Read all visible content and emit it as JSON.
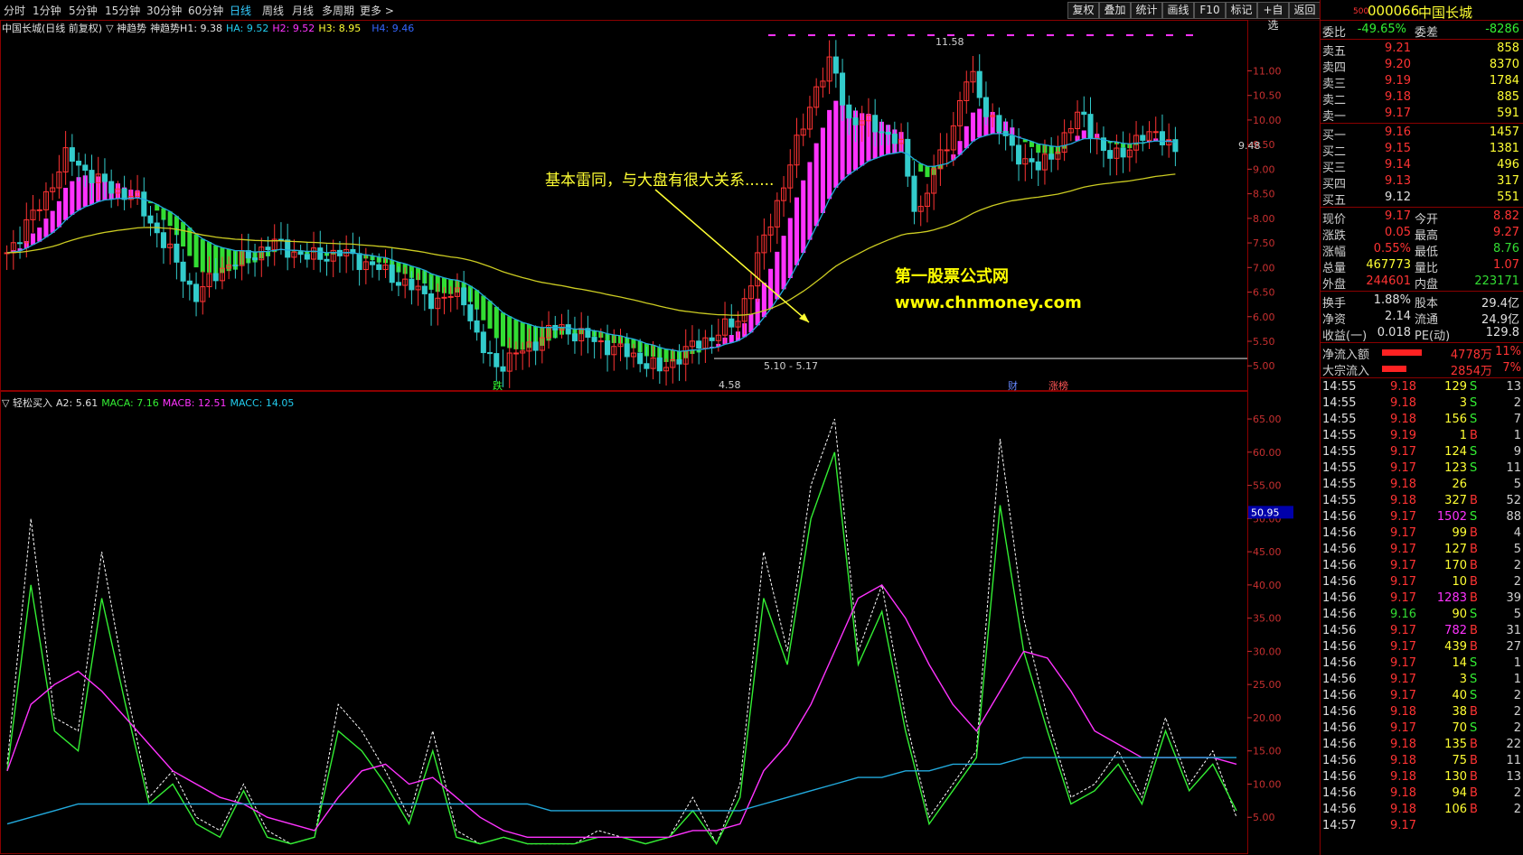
{
  "toolbar": {
    "periods": [
      "分时",
      "1分钟",
      "5分钟",
      "15分钟",
      "30分钟",
      "60分钟",
      "日线",
      "周线",
      "月线",
      "多周期",
      "更多 >"
    ],
    "active_period": "日线",
    "buttons": [
      "复权",
      "叠加",
      "统计",
      "画线",
      "F10",
      "标记",
      "+自选",
      "返回"
    ]
  },
  "main_chart": {
    "legend": {
      "title": "中国长城(日线 前复权)",
      "indicator": "▽ 神趋势",
      "indicator2": "神趋势H1: 9.38",
      "ha": "HA: 9.52",
      "h2": "H2: 9.52",
      "h3": "H3: 8.95",
      "h4": "H4: 9.46"
    },
    "price_axis": [
      "11.00",
      "10.50",
      "10.00",
      "9.50",
      "9.00",
      "8.50",
      "8.00",
      "7.50",
      "7.00",
      "6.50",
      "6.00",
      "5.50",
      "5.00"
    ],
    "price_axis_values": [
      11.0,
      10.5,
      10.0,
      9.5,
      9.0,
      8.5,
      8.0,
      7.5,
      7.0,
      6.5,
      6.0,
      5.5,
      5.0
    ],
    "price_range": [
      4.6,
      12.0
    ],
    "high_label": "11.58",
    "low_label": "4.58",
    "range_label": "5.10 - 5.17",
    "last_label": "9.48",
    "annotation": "基本雷同，与大盘有很大关系......",
    "watermark_name": "第一股票公式网",
    "watermark_url": "www.chnmoney.com",
    "event_tags": [
      "跌",
      "财",
      "涨榜"
    ],
    "colors": {
      "up_bar": "#ff33ff",
      "down_bar": "#33dd33",
      "ma_fast": "#22aadd",
      "ma_slow": "#cccc22",
      "candle_up": "#ff3333",
      "candle_down": "#33cccc"
    }
  },
  "sub_chart": {
    "legend": {
      "title": "▽ 轻松买入",
      "a2": "A2: 5.61",
      "maca": "MACA: 7.16",
      "macb": "MACB: 12.51",
      "macc": "MACC: 14.05"
    },
    "axis": [
      "65.00",
      "60.00",
      "55.00",
      "50.00",
      "45.00",
      "40.00",
      "35.00",
      "30.00",
      "25.00",
      "20.00",
      "15.00",
      "10.00",
      "5.00"
    ],
    "axis_values": [
      65,
      60,
      55,
      50,
      45,
      40,
      35,
      30,
      25,
      20,
      15,
      10,
      5
    ],
    "range": [
      0,
      68
    ],
    "current_marker": "50.95",
    "current_value": 50.95
  },
  "chart_data": {
    "type": "line",
    "x_description": "daily bars",
    "series": [
      {
        "name": "A2",
        "values": [
          13,
          50,
          20,
          18,
          45,
          25,
          8,
          12,
          5,
          3,
          10,
          3,
          1,
          2,
          22,
          18,
          12,
          5,
          18,
          3,
          1,
          2,
          1,
          1,
          1,
          3,
          2,
          1,
          2,
          8,
          1,
          10,
          45,
          30,
          55,
          65,
          30,
          40,
          20,
          5,
          10,
          15,
          62,
          35,
          20,
          8,
          10,
          15,
          8,
          20,
          10,
          15,
          5
        ]
      },
      {
        "name": "MACA",
        "values": [
          12,
          40,
          18,
          15,
          38,
          22,
          7,
          10,
          4,
          2,
          9,
          2,
          1,
          2,
          18,
          15,
          10,
          4,
          15,
          2,
          1,
          2,
          1,
          1,
          1,
          2,
          2,
          1,
          2,
          6,
          1,
          8,
          38,
          28,
          50,
          60,
          28,
          36,
          18,
          4,
          9,
          14,
          52,
          30,
          18,
          7,
          9,
          13,
          7,
          18,
          9,
          13,
          6
        ]
      },
      {
        "name": "MACB",
        "values": [
          12,
          22,
          25,
          27,
          24,
          20,
          16,
          12,
          10,
          8,
          7,
          5,
          4,
          3,
          8,
          12,
          13,
          10,
          11,
          8,
          5,
          3,
          2,
          2,
          2,
          2,
          2,
          2,
          2,
          3,
          3,
          4,
          12,
          16,
          22,
          30,
          38,
          40,
          35,
          28,
          22,
          18,
          24,
          30,
          29,
          24,
          18,
          16,
          14,
          14,
          14,
          14,
          13
        ]
      },
      {
        "name": "MACC",
        "values": [
          4,
          5,
          6,
          7,
          7,
          7,
          7,
          7,
          7,
          7,
          7,
          7,
          7,
          7,
          7,
          7,
          7,
          7,
          7,
          7,
          7,
          7,
          7,
          6,
          6,
          6,
          6,
          6,
          6,
          6,
          6,
          6,
          7,
          8,
          9,
          10,
          11,
          11,
          12,
          12,
          13,
          13,
          13,
          14,
          14,
          14,
          14,
          14,
          14,
          14,
          14,
          14,
          14
        ]
      }
    ],
    "ylim": [
      0,
      68
    ]
  },
  "quote_panel": {
    "header": {
      "code_prefix": "500",
      "code": "000066",
      "name": "中国长城"
    },
    "weibi": {
      "label": "委比",
      "value": "-49.65%",
      "label2": "委差",
      "value2": "-8286"
    },
    "asks": [
      {
        "label": "卖五",
        "price": "9.21",
        "vol": "858"
      },
      {
        "label": "卖四",
        "price": "9.20",
        "vol": "8370"
      },
      {
        "label": "卖三",
        "price": "9.19",
        "vol": "1784"
      },
      {
        "label": "卖二",
        "price": "9.18",
        "vol": "885"
      },
      {
        "label": "卖一",
        "price": "9.17",
        "vol": "591"
      }
    ],
    "bids": [
      {
        "label": "买一",
        "price": "9.16",
        "vol": "1457"
      },
      {
        "label": "买二",
        "price": "9.15",
        "vol": "1381"
      },
      {
        "label": "买三",
        "price": "9.14",
        "vol": "496"
      },
      {
        "label": "买四",
        "price": "9.13",
        "vol": "317"
      },
      {
        "label": "买五",
        "price": "9.12",
        "vol": "551"
      }
    ],
    "stats": [
      {
        "l1": "现价",
        "v1": "9.17",
        "l2": "今开",
        "v2": "8.82",
        "c1": "#ff3333",
        "c2": "#ff3333"
      },
      {
        "l1": "涨跌",
        "v1": "0.05",
        "l2": "最高",
        "v2": "9.27",
        "c1": "#ff3333",
        "c2": "#ff3333"
      },
      {
        "l1": "涨幅",
        "v1": "0.55%",
        "l2": "最低",
        "v2": "8.76",
        "c1": "#ff3333",
        "c2": "#33dd33"
      },
      {
        "l1": "总量",
        "v1": "467773",
        "l2": "量比",
        "v2": "1.07",
        "c1": "#ffff33",
        "c2": "#ff3333"
      },
      {
        "l1": "外盘",
        "v1": "244601",
        "l2": "内盘",
        "v2": "223171",
        "c1": "#ff3333",
        "c2": "#33dd33"
      }
    ],
    "stats2": [
      {
        "l1": "换手",
        "v1": "1.88%",
        "l2": "股本",
        "v2": "29.4亿"
      },
      {
        "l1": "净资",
        "v1": "2.14",
        "l2": "流通",
        "v2": "24.9亿"
      },
      {
        "l1": "收益(一)",
        "v1": "0.018",
        "l2": "PE(动)",
        "v2": "129.8"
      }
    ],
    "flows": [
      {
        "label": "净流入额",
        "value": "4778万",
        "pct": "11%",
        "bar": 1.0
      },
      {
        "label": "大宗流入",
        "value": "2854万",
        "pct": "7%",
        "bar": 0.62
      }
    ],
    "ticks": [
      {
        "t": "14:55",
        "p": "9.18",
        "v": "129",
        "bs": "S",
        "n": "13",
        "pc": "#ff3333"
      },
      {
        "t": "14:55",
        "p": "9.18",
        "v": "3",
        "bs": "S",
        "n": "2",
        "pc": "#ff3333"
      },
      {
        "t": "14:55",
        "p": "9.18",
        "v": "156",
        "bs": "S",
        "n": "7",
        "pc": "#ff3333"
      },
      {
        "t": "14:55",
        "p": "9.19",
        "v": "1",
        "bs": "B",
        "n": "1",
        "pc": "#ff3333"
      },
      {
        "t": "14:55",
        "p": "9.17",
        "v": "124",
        "bs": "S",
        "n": "9",
        "pc": "#ff3333"
      },
      {
        "t": "14:55",
        "p": "9.17",
        "v": "123",
        "bs": "S",
        "n": "11",
        "pc": "#ff3333"
      },
      {
        "t": "14:55",
        "p": "9.18",
        "v": "26",
        "bs": "",
        "n": "5",
        "pc": "#ff3333"
      },
      {
        "t": "14:55",
        "p": "9.18",
        "v": "327",
        "bs": "B",
        "n": "52",
        "pc": "#ff3333"
      },
      {
        "t": "14:56",
        "p": "9.17",
        "v": "1502",
        "bs": "S",
        "n": "88",
        "pc": "#ff3333"
      },
      {
        "t": "14:56",
        "p": "9.17",
        "v": "99",
        "bs": "B",
        "n": "4",
        "pc": "#ff3333"
      },
      {
        "t": "14:56",
        "p": "9.17",
        "v": "127",
        "bs": "B",
        "n": "5",
        "pc": "#ff3333"
      },
      {
        "t": "14:56",
        "p": "9.17",
        "v": "170",
        "bs": "B",
        "n": "2",
        "pc": "#ff3333"
      },
      {
        "t": "14:56",
        "p": "9.17",
        "v": "10",
        "bs": "B",
        "n": "2",
        "pc": "#ff3333"
      },
      {
        "t": "14:56",
        "p": "9.17",
        "v": "1283",
        "bs": "B",
        "n": "39",
        "pc": "#ff3333"
      },
      {
        "t": "14:56",
        "p": "9.16",
        "v": "90",
        "bs": "S",
        "n": "5",
        "pc": "#33dd33"
      },
      {
        "t": "14:56",
        "p": "9.17",
        "v": "782",
        "bs": "B",
        "n": "31",
        "pc": "#ff3333"
      },
      {
        "t": "14:56",
        "p": "9.17",
        "v": "439",
        "bs": "B",
        "n": "27",
        "pc": "#ff3333"
      },
      {
        "t": "14:56",
        "p": "9.17",
        "v": "14",
        "bs": "S",
        "n": "1",
        "pc": "#ff3333"
      },
      {
        "t": "14:56",
        "p": "9.17",
        "v": "3",
        "bs": "S",
        "n": "1",
        "pc": "#ff3333"
      },
      {
        "t": "14:56",
        "p": "9.17",
        "v": "40",
        "bs": "S",
        "n": "2",
        "pc": "#ff3333"
      },
      {
        "t": "14:56",
        "p": "9.18",
        "v": "38",
        "bs": "B",
        "n": "2",
        "pc": "#ff3333"
      },
      {
        "t": "14:56",
        "p": "9.17",
        "v": "70",
        "bs": "S",
        "n": "2",
        "pc": "#ff3333"
      },
      {
        "t": "14:56",
        "p": "9.18",
        "v": "135",
        "bs": "B",
        "n": "22",
        "pc": "#ff3333"
      },
      {
        "t": "14:56",
        "p": "9.18",
        "v": "75",
        "bs": "B",
        "n": "11",
        "pc": "#ff3333"
      },
      {
        "t": "14:56",
        "p": "9.18",
        "v": "130",
        "bs": "B",
        "n": "13",
        "pc": "#ff3333"
      },
      {
        "t": "14:56",
        "p": "9.18",
        "v": "94",
        "bs": "B",
        "n": "2",
        "pc": "#ff3333"
      },
      {
        "t": "14:56",
        "p": "9.18",
        "v": "106",
        "bs": "B",
        "n": "2",
        "pc": "#ff3333"
      },
      {
        "t": "14:57",
        "p": "9.17",
        "v": "",
        "bs": "",
        "n": "",
        "pc": "#ff3333"
      }
    ]
  }
}
